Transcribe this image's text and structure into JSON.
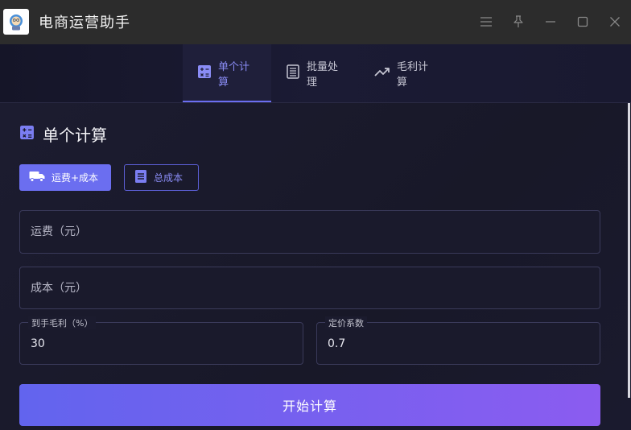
{
  "window": {
    "title": "电商运营助手",
    "controls": [
      "menu-icon",
      "pin-icon",
      "minimize-icon",
      "maximize-icon",
      "close-icon"
    ]
  },
  "tabs": [
    {
      "label": "单个计算",
      "icon": "calculator-icon",
      "active": true
    },
    {
      "label": "批量处理",
      "icon": "list-icon",
      "active": false
    },
    {
      "label": "毛利计算",
      "icon": "trending-up-icon",
      "active": false
    }
  ],
  "section": {
    "title": "单个计算",
    "icon": "calculator-icon"
  },
  "modes": [
    {
      "label": "运费+成本",
      "icon": "truck-icon",
      "selected": true
    },
    {
      "label": "总成本",
      "icon": "document-icon",
      "selected": false
    }
  ],
  "form": {
    "shipping": {
      "placeholder": "运费（元）",
      "value": ""
    },
    "cost": {
      "placeholder": "成本（元）",
      "value": ""
    },
    "margin": {
      "label": "到手毛利（%）",
      "value": "30"
    },
    "coefficient": {
      "label": "定价系数",
      "value": "0.7"
    },
    "submit_label": "开始计算"
  },
  "colors": {
    "accent": "#6b6ef0",
    "accent_end": "#8b5cf0",
    "titlebar": "#2c2c2c",
    "background": "#161628"
  }
}
